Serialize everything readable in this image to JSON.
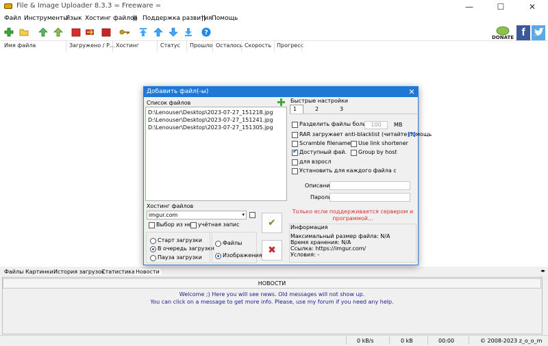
{
  "window": {
    "title": "File & Image Uploader 8.3.3  = Freeware =",
    "min": "—",
    "max": "☐",
    "close": "✕"
  },
  "menu": [
    "Файл",
    "Инструменты",
    "Язык",
    "Хостинг файлов",
    "||",
    "Поддержка развития",
    "||",
    "Помощь"
  ],
  "toolbar": {
    "donate_label": "DONATE",
    "fb": "f"
  },
  "columns": [
    "Имя файла",
    "Загружено / Р...",
    "Хостинг",
    "Статус",
    "Прошло",
    "Осталось",
    "Скорость",
    "Прогресс"
  ],
  "bottom_tabs": [
    "Файлы",
    "Картинки",
    "История загрузок",
    "Статистика",
    "Новости"
  ],
  "news": {
    "header": "НОВОСТИ",
    "line1": "Welcome ;) Here you will see news. Old messages will not show up.",
    "line2": "You can click on a message to get more info. Please, use my forum if you need any help."
  },
  "status": {
    "speed": "0 kB/s",
    "size": "0 kB",
    "time": "00:00",
    "copyright": "© 2008-2023 z_o_o_m"
  },
  "dialog": {
    "title": "Добавить файл(-ы)",
    "file_list_label": "Список файлов",
    "files": [
      "D:\\Lenouser\\Desktop\\2023-07-27_151218.jpg",
      "D:\\Lenouser\\Desktop\\2023-07-27_151241.jpg",
      "D:\\Lenouser\\Desktop\\2023-07-27_151305.jpg"
    ],
    "hosting_label": "Хостинг файлов",
    "hosting_value": "imgur.com",
    "choose_from_list": "Выбор из нес",
    "account": "учётная запис",
    "start_upload": "Старт загрузки",
    "queue": "В очередь загрузки",
    "pause": "Пауза загрузки",
    "files_radio": "Файлы",
    "images_radio": "Изображения",
    "quick_settings": "Быстрые настройки",
    "tabs": [
      "1",
      "2",
      "3"
    ],
    "split_label": "Разделить файлы больше че",
    "split_value": "100",
    "split_unit": "MB",
    "rar_label": "RAR загружает anti-blacklist (читайте помощь",
    "rar_help": "[?]",
    "scramble": "Scramble filename",
    "link_shortener": "Use link shortener",
    "public": "Доступный фай.",
    "group_host": "Group by host",
    "adult": "для взросл",
    "per_file": "Установить для каждого файла с",
    "desc_label": "Описание:",
    "pass_label": "Пароль:",
    "note": "Только если поддерживается сервером и программой...",
    "info_label": "Информация",
    "info_lines": [
      "Максимальный размер файла: N/A",
      "Время хранения: N/A",
      "Ссылка: https://imgur.com/",
      "Условия: -"
    ]
  }
}
